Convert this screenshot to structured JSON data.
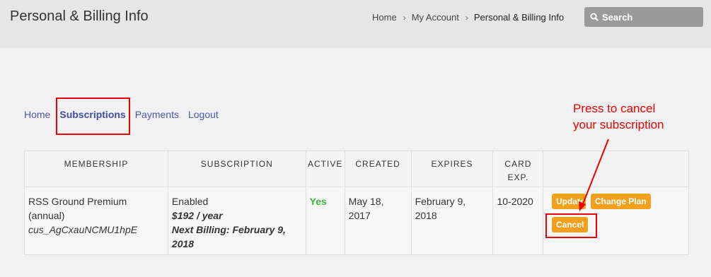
{
  "header": {
    "title": "Personal & Billing Info",
    "breadcrumb": [
      "Home",
      "My Account",
      "Personal & Billing Info"
    ],
    "search_placeholder": "Search"
  },
  "tabs": [
    "Home",
    "Subscriptions",
    "Payments",
    "Logout"
  ],
  "table": {
    "headers": [
      "MEMBERSHIP",
      "SUBSCRIPTION",
      "ACTIVE",
      "CREATED",
      "EXPIRES",
      "CARD EXP."
    ],
    "row": {
      "membership": "RSS Ground Premium (annual)",
      "customer_id": "cus_AgCxauNCMU1hpE",
      "subscription_status": "Enabled",
      "price": "$192 / year",
      "next_billing": "Next Billing: February 9, 2018",
      "active": "Yes",
      "created": "May 18, 2017",
      "expires": "February 9, 2018",
      "card_exp": "10-2020"
    },
    "buttons": {
      "update": "Update",
      "change_plan": "Change Plan",
      "cancel": "Cancel"
    }
  },
  "annotation": {
    "line1": "Press to cancel",
    "line2": "your subscription"
  },
  "colors": {
    "accent_button": "#f0a01a",
    "highlight": "#e00000",
    "active_yes": "#3bb23b",
    "link": "#4a5aa8"
  }
}
